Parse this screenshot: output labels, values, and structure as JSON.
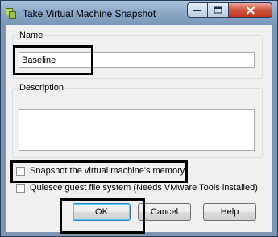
{
  "window": {
    "title": "Take Virtual Machine Snapshot",
    "icon": "vm-snapshot-icon"
  },
  "name_group": {
    "legend": "Name",
    "value": "Baseline"
  },
  "description_group": {
    "legend": "Description",
    "value": ""
  },
  "options": {
    "snapshot_memory_label": "Snapshot the virtual machine's memory",
    "snapshot_memory_checked": false,
    "quiesce_label": "Quiesce guest file system (Needs VMware Tools installed)",
    "quiesce_checked": false
  },
  "buttons": {
    "ok": "OK",
    "cancel": "Cancel",
    "help": "Help"
  },
  "colors": {
    "highlight_box": "#000000",
    "close_button": "#c1361e"
  }
}
